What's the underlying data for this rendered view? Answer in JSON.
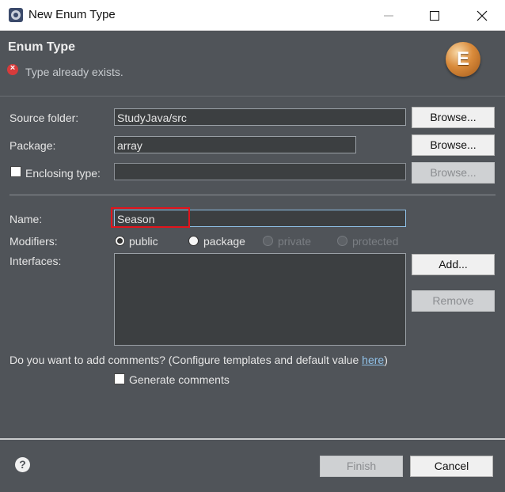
{
  "window": {
    "title": "New Enum Type",
    "icon": "eclipse-gear-icon"
  },
  "banner": {
    "title": "Enum Type",
    "message": "Type already exists.",
    "logo_letter": "E"
  },
  "form": {
    "source_folder": {
      "label": "Source folder:",
      "value": "StudyJava/src",
      "button": "Browse..."
    },
    "package": {
      "label": "Package:",
      "value": "array",
      "button": "Browse..."
    },
    "enclosing_type": {
      "label": "Enclosing type:",
      "value": "",
      "checked": false,
      "button": "Browse..."
    },
    "name": {
      "label": "Name:",
      "value": "Season"
    },
    "modifiers": {
      "label": "Modifiers:",
      "options": [
        {
          "label": "public",
          "selected": true,
          "enabled": true
        },
        {
          "label": "package",
          "selected": false,
          "enabled": true
        },
        {
          "label": "private",
          "selected": false,
          "enabled": false
        },
        {
          "label": "protected",
          "selected": false,
          "enabled": false
        }
      ]
    },
    "interfaces": {
      "label": "Interfaces:",
      "add_button": "Add...",
      "remove_button": "Remove"
    },
    "comments": {
      "question_prefix": "Do you want to add comments? (Configure templates and default value ",
      "link": "here",
      "question_suffix": ")",
      "generate_label": "Generate comments",
      "generate_checked": false
    }
  },
  "footer": {
    "finish": "Finish",
    "cancel": "Cancel"
  },
  "colors": {
    "background": "#505459",
    "error": "#d83b3b",
    "highlight": "#e2141c",
    "link": "#8fc1e8"
  }
}
